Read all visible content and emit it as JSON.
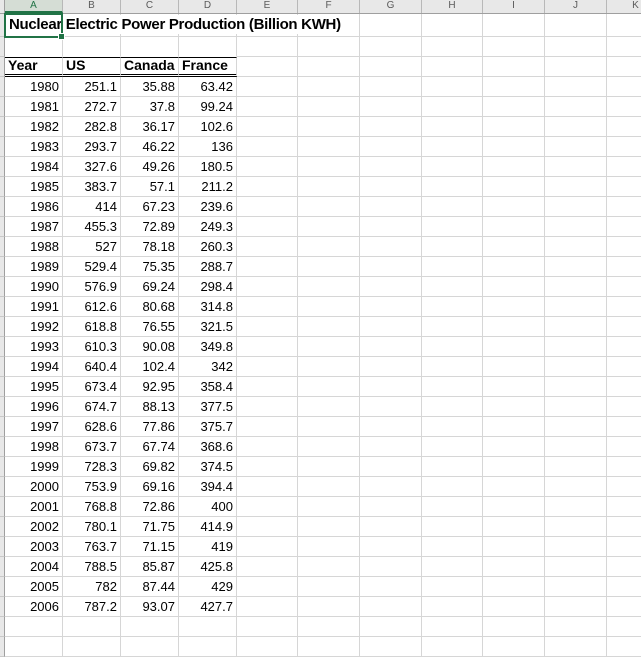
{
  "colors": {
    "accent_green": "#217346",
    "gridline": "#d6d6d6",
    "header_bg": "#e8e8e8",
    "selected_header_bg": "#d5ddd5",
    "header_text": "#5a5a5a",
    "cell_text": "#000000"
  },
  "sheet": {
    "column_headers": [
      "A",
      "B",
      "C",
      "D",
      "E",
      "F",
      "G",
      "H",
      "I",
      "J",
      "K"
    ],
    "selected_column": "A",
    "title": "Nuclear Electric Power Production (Billion KWH)",
    "table": {
      "headers": [
        "Year",
        "US",
        "Canada",
        "France"
      ],
      "rows": [
        [
          "1980",
          "251.1",
          "35.88",
          "63.42"
        ],
        [
          "1981",
          "272.7",
          "37.8",
          "99.24"
        ],
        [
          "1982",
          "282.8",
          "36.17",
          "102.6"
        ],
        [
          "1983",
          "293.7",
          "46.22",
          "136"
        ],
        [
          "1984",
          "327.6",
          "49.26",
          "180.5"
        ],
        [
          "1985",
          "383.7",
          "57.1",
          "211.2"
        ],
        [
          "1986",
          "414",
          "67.23",
          "239.6"
        ],
        [
          "1987",
          "455.3",
          "72.89",
          "249.3"
        ],
        [
          "1988",
          "527",
          "78.18",
          "260.3"
        ],
        [
          "1989",
          "529.4",
          "75.35",
          "288.7"
        ],
        [
          "1990",
          "576.9",
          "69.24",
          "298.4"
        ],
        [
          "1991",
          "612.6",
          "80.68",
          "314.8"
        ],
        [
          "1992",
          "618.8",
          "76.55",
          "321.5"
        ],
        [
          "1993",
          "610.3",
          "90.08",
          "349.8"
        ],
        [
          "1994",
          "640.4",
          "102.4",
          "342"
        ],
        [
          "1995",
          "673.4",
          "92.95",
          "358.4"
        ],
        [
          "1996",
          "674.7",
          "88.13",
          "377.5"
        ],
        [
          "1997",
          "628.6",
          "77.86",
          "375.7"
        ],
        [
          "1998",
          "673.7",
          "67.74",
          "368.6"
        ],
        [
          "1999",
          "728.3",
          "69.82",
          "374.5"
        ],
        [
          "2000",
          "753.9",
          "69.16",
          "394.4"
        ],
        [
          "2001",
          "768.8",
          "72.86",
          "400"
        ],
        [
          "2002",
          "780.1",
          "71.75",
          "414.9"
        ],
        [
          "2003",
          "763.7",
          "71.15",
          "419"
        ],
        [
          "2004",
          "788.5",
          "85.87",
          "425.8"
        ],
        [
          "2005",
          "782",
          "87.44",
          "429"
        ],
        [
          "2006",
          "787.2",
          "93.07",
          "427.7"
        ]
      ]
    }
  }
}
